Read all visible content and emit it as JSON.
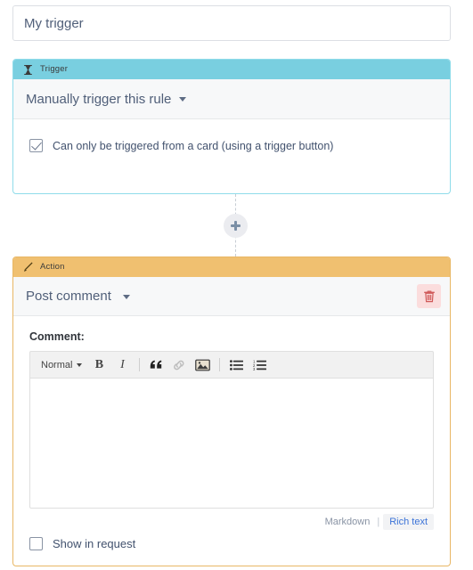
{
  "rule_name": {
    "value": "My trigger",
    "placeholder": "Rule name"
  },
  "trigger_card": {
    "header_label": "Trigger",
    "header_icon": "hourglass-icon",
    "header_color": "#79cfe0",
    "border_color": "#8fdcea",
    "selected_trigger": "Manually trigger this rule",
    "option_checkbox": {
      "label": "Can only be triggered from a card (using a trigger button)",
      "checked": true
    }
  },
  "connector": {
    "add_button_icon": "plus-icon",
    "add_button_label": "+"
  },
  "action_card": {
    "header_label": "Action",
    "header_icon": "magic-wand-icon",
    "header_color": "#f0c070",
    "border_color": "#e8b765",
    "selected_action": "Post comment",
    "delete_button_icon": "trash-icon",
    "delete_button_color": "#de5757",
    "comment_label": "Comment:",
    "editor": {
      "value": "",
      "toolbar": {
        "format_label": "Normal",
        "bold_label": "B",
        "italic_label": "I",
        "quote_icon": "quote-icon",
        "link_icon": "link-icon",
        "image_icon": "image-icon",
        "bullet_list_icon": "bullet-list-icon",
        "numbered_list_icon": "numbered-list-icon"
      },
      "mode": {
        "markdown_label": "Markdown",
        "separator": "|",
        "rich_text_label": "Rich text",
        "active": "Rich text",
        "active_color": "#3b73d8"
      }
    },
    "show_in_request": {
      "label": "Show in request",
      "checked": false
    }
  }
}
